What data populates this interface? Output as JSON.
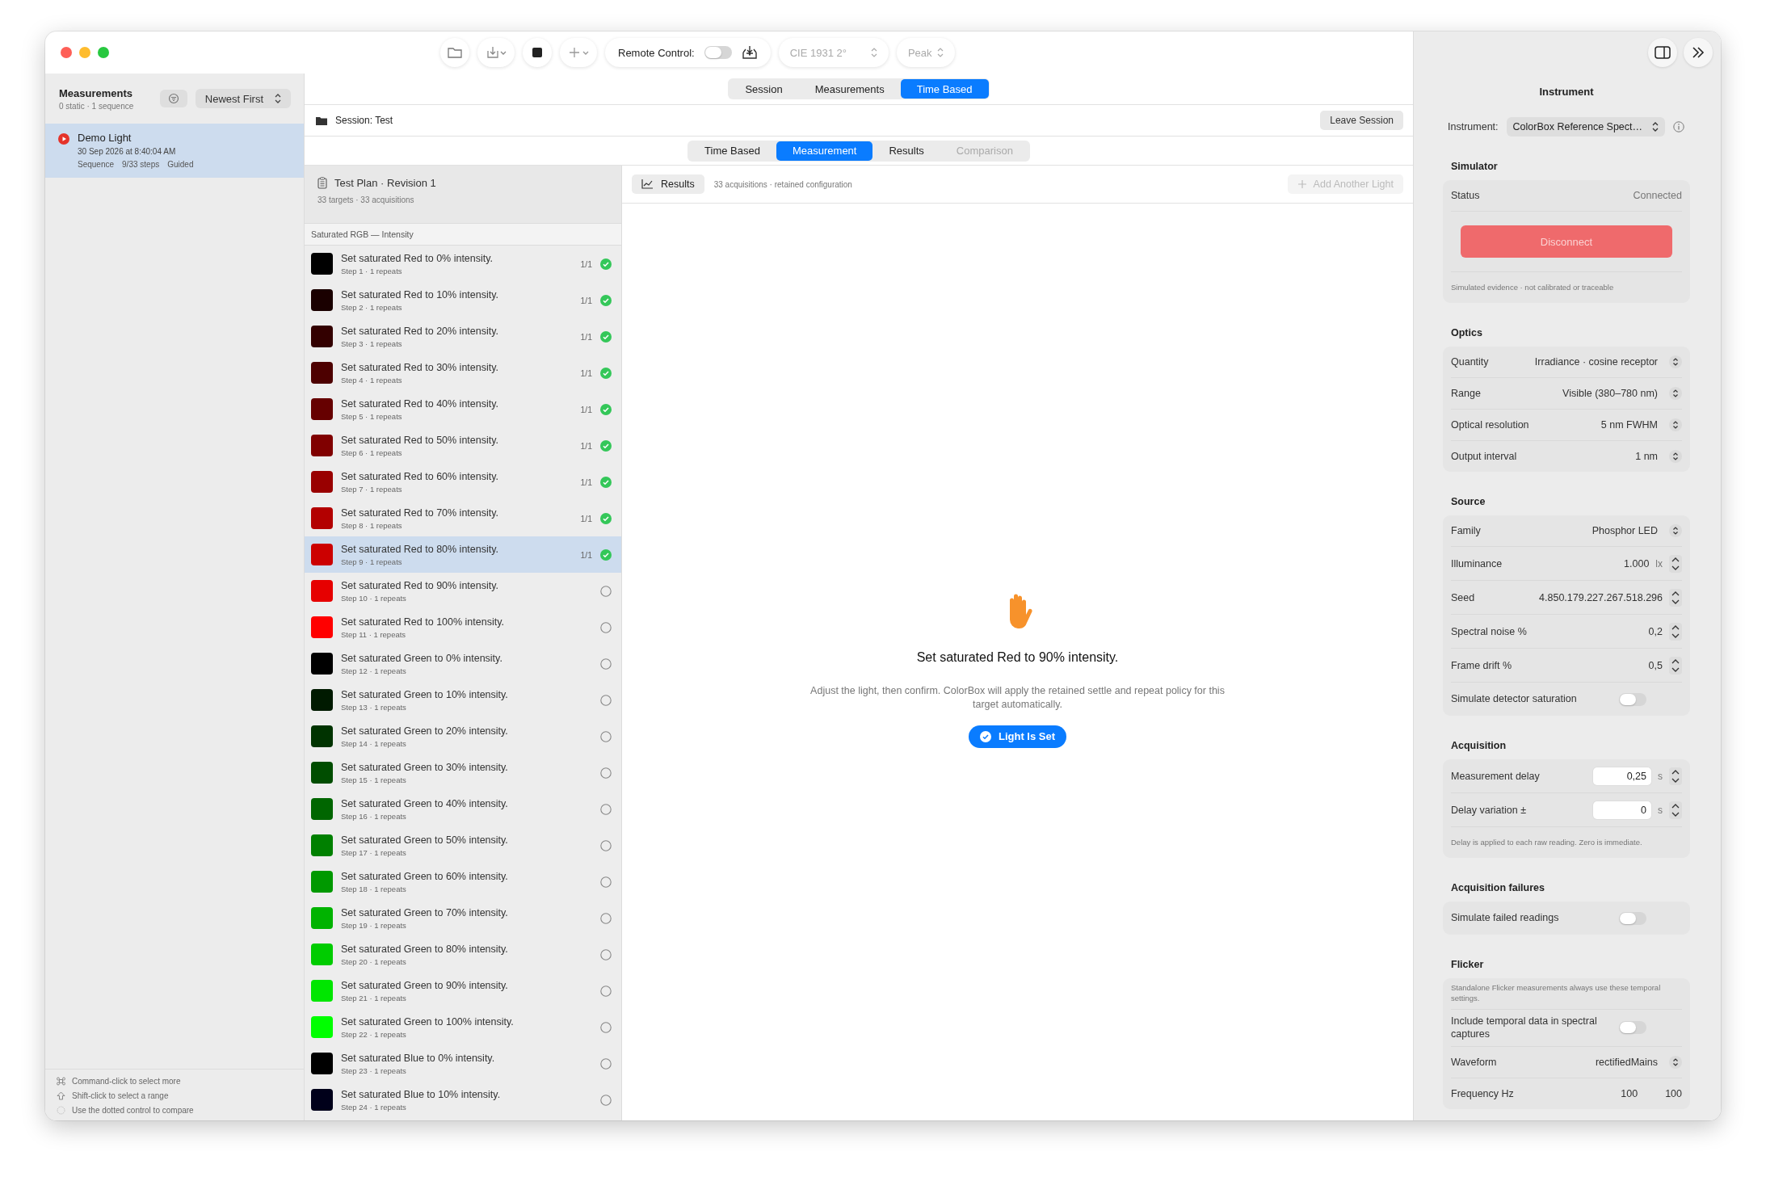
{
  "toolbar": {
    "remote_control": {
      "label": "Remote Control:",
      "on": false
    },
    "observer": {
      "value": "CIE 1931 2°",
      "disabled": true
    },
    "mode": {
      "value": "Peak",
      "disabled": true
    }
  },
  "main_tabs": [
    {
      "label": "Session",
      "selected": false
    },
    {
      "label": "Measurements",
      "selected": false
    },
    {
      "label": "Time Based",
      "selected": true
    }
  ],
  "sidebar": {
    "title": "Measurements",
    "subtitle": "0 static · 1 sequence",
    "sort": "Newest First",
    "items": [
      {
        "name": "Demo Light",
        "date": "30 Sep 2026 at 8:40:04 AM",
        "details": [
          "Sequence",
          "9/33 steps",
          "Guided"
        ],
        "selected": true
      }
    ],
    "hints": [
      {
        "kind": "command",
        "text": "Command-click to select more"
      },
      {
        "kind": "shift",
        "text": "Shift-click to select a range"
      },
      {
        "kind": "dotted",
        "text": "Use the dotted control to compare"
      }
    ]
  },
  "session": {
    "label": "Session: Test",
    "leave_button": "Leave Session"
  },
  "sub_tabs": [
    {
      "label": "Time Based",
      "selected": false,
      "disabled": false
    },
    {
      "label": "Measurement",
      "selected": true,
      "disabled": false
    },
    {
      "label": "Results",
      "selected": false,
      "disabled": false
    },
    {
      "label": "Comparison",
      "selected": false,
      "disabled": true
    }
  ],
  "plan": {
    "title": "Test Plan · Revision 1",
    "summary": "33 targets · 33 acquisitions",
    "section": "Saturated RGB — Intensity",
    "steps": [
      {
        "title": "Set saturated Red to 0% intensity.",
        "detail": "Step 1 · 1 repeats",
        "color": "#000000",
        "done": true,
        "count": "1/1",
        "selected": false
      },
      {
        "title": "Set saturated Red to 10% intensity.",
        "detail": "Step 2 · 1 repeats",
        "color": "#1a0000",
        "done": true,
        "count": "1/1",
        "selected": false
      },
      {
        "title": "Set saturated Red to 20% intensity.",
        "detail": "Step 3 · 1 repeats",
        "color": "#330000",
        "done": true,
        "count": "1/1",
        "selected": false
      },
      {
        "title": "Set saturated Red to 30% intensity.",
        "detail": "Step 4 · 1 repeats",
        "color": "#4d0000",
        "done": true,
        "count": "1/1",
        "selected": false
      },
      {
        "title": "Set saturated Red to 40% intensity.",
        "detail": "Step 5 · 1 repeats",
        "color": "#660000",
        "done": true,
        "count": "1/1",
        "selected": false
      },
      {
        "title": "Set saturated Red to 50% intensity.",
        "detail": "Step 6 · 1 repeats",
        "color": "#800000",
        "done": true,
        "count": "1/1",
        "selected": false
      },
      {
        "title": "Set saturated Red to 60% intensity.",
        "detail": "Step 7 · 1 repeats",
        "color": "#990000",
        "done": true,
        "count": "1/1",
        "selected": false
      },
      {
        "title": "Set saturated Red to 70% intensity.",
        "detail": "Step 8 · 1 repeats",
        "color": "#b30000",
        "done": true,
        "count": "1/1",
        "selected": false
      },
      {
        "title": "Set saturated Red to 80% intensity.",
        "detail": "Step 9 · 1 repeats",
        "color": "#cc0000",
        "done": true,
        "count": "1/1",
        "selected": true
      },
      {
        "title": "Set saturated Red to 90% intensity.",
        "detail": "Step 10 · 1 repeats",
        "color": "#e60000",
        "done": false,
        "selected": false
      },
      {
        "title": "Set saturated Red to 100% intensity.",
        "detail": "Step 11 · 1 repeats",
        "color": "#ff0000",
        "done": false,
        "selected": false
      },
      {
        "title": "Set saturated Green to 0% intensity.",
        "detail": "Step 12 · 1 repeats",
        "color": "#000000",
        "done": false,
        "selected": false
      },
      {
        "title": "Set saturated Green to 10% intensity.",
        "detail": "Step 13 · 1 repeats",
        "color": "#001a00",
        "done": false,
        "selected": false
      },
      {
        "title": "Set saturated Green to 20% intensity.",
        "detail": "Step 14 · 1 repeats",
        "color": "#003300",
        "done": false,
        "selected": false
      },
      {
        "title": "Set saturated Green to 30% intensity.",
        "detail": "Step 15 · 1 repeats",
        "color": "#004d00",
        "done": false,
        "selected": false
      },
      {
        "title": "Set saturated Green to 40% intensity.",
        "detail": "Step 16 · 1 repeats",
        "color": "#006600",
        "done": false,
        "selected": false
      },
      {
        "title": "Set saturated Green to 50% intensity.",
        "detail": "Step 17 · 1 repeats",
        "color": "#008000",
        "done": false,
        "selected": false
      },
      {
        "title": "Set saturated Green to 60% intensity.",
        "detail": "Step 18 · 1 repeats",
        "color": "#009900",
        "done": false,
        "selected": false
      },
      {
        "title": "Set saturated Green to 70% intensity.",
        "detail": "Step 19 · 1 repeats",
        "color": "#00b300",
        "done": false,
        "selected": false
      },
      {
        "title": "Set saturated Green to 80% intensity.",
        "detail": "Step 20 · 1 repeats",
        "color": "#00cc00",
        "done": false,
        "selected": false
      },
      {
        "title": "Set saturated Green to 90% intensity.",
        "detail": "Step 21 · 1 repeats",
        "color": "#00e600",
        "done": false,
        "selected": false
      },
      {
        "title": "Set saturated Green to 100% intensity.",
        "detail": "Step 22 · 1 repeats",
        "color": "#00ff00",
        "done": false,
        "selected": false
      },
      {
        "title": "Set saturated Blue to 0% intensity.",
        "detail": "Step 23 · 1 repeats",
        "color": "#000000",
        "done": false,
        "selected": false
      },
      {
        "title": "Set saturated Blue to 10% intensity.",
        "detail": "Step 24 · 1 repeats",
        "color": "#00001a",
        "done": false,
        "selected": false
      }
    ]
  },
  "results_bar": {
    "button": "Results",
    "summary": "33 acquisitions · retained configuration",
    "add_button": {
      "label": "Add Another Light",
      "disabled": true
    }
  },
  "prompt": {
    "title": "Set saturated Red to 90% intensity.",
    "description": "Adjust the light, then confirm. ColorBox will apply the retained settle and repeat policy for this target automatically.",
    "button": "Light Is Set"
  },
  "inspector": {
    "title": "Instrument",
    "instrument": {
      "label": "Instrument:",
      "value": "ColorBox Reference Spect…"
    },
    "sections": [
      {
        "title": "Simulator",
        "rows": [
          {
            "kind": "value",
            "label": "Status",
            "value": "Connected"
          },
          {
            "kind": "button",
            "label": "Disconnect"
          },
          {
            "kind": "note",
            "text": "Simulated evidence · not calibrated or traceable"
          }
        ]
      },
      {
        "title": "Optics",
        "rows": [
          {
            "kind": "popup",
            "label": "Quantity",
            "value": "Irradiance · cosine receptor"
          },
          {
            "kind": "popup",
            "label": "Range",
            "value": "Visible (380–780 nm)"
          },
          {
            "kind": "popup",
            "label": "Optical resolution",
            "value": "5 nm FWHM"
          },
          {
            "kind": "popup",
            "label": "Output interval",
            "value": "1 nm"
          }
        ]
      },
      {
        "title": "Source",
        "rows": [
          {
            "kind": "popup",
            "label": "Family",
            "value": "Phosphor LED"
          },
          {
            "kind": "stepper",
            "label": "Illuminance",
            "value": "1.000",
            "unit": "lx"
          },
          {
            "kind": "stepper",
            "label": "Seed",
            "value": "4.850.179.227.267.518.296"
          },
          {
            "kind": "stepper",
            "label": "Spectral noise %",
            "value": "0,2"
          },
          {
            "kind": "stepper",
            "label": "Frame drift %",
            "value": "0,5"
          },
          {
            "kind": "toggle",
            "label": "Simulate detector saturation",
            "on": false
          }
        ]
      },
      {
        "title": "Acquisition",
        "rows": [
          {
            "kind": "field",
            "label": "Measurement delay",
            "value": "0,25",
            "unit": "s"
          },
          {
            "kind": "field",
            "label": "Delay variation ±",
            "value": "0",
            "unit": "s"
          },
          {
            "kind": "note",
            "text": "Delay is applied to each raw reading. Zero is immediate."
          }
        ]
      },
      {
        "title": "Acquisition failures",
        "rows": [
          {
            "kind": "toggle",
            "label": "Simulate failed readings",
            "on": false
          }
        ]
      },
      {
        "title": "Flicker",
        "rows": [
          {
            "kind": "note",
            "text": "Standalone Flicker measurements always use these temporal settings."
          },
          {
            "kind": "toggle",
            "label": "Include temporal data in spectral captures",
            "on": false
          },
          {
            "kind": "popup",
            "label": "Waveform",
            "value": "rectifiedMains"
          },
          {
            "kind": "pair",
            "label": "Frequency Hz",
            "value": "100",
            "value2": "100"
          }
        ]
      }
    ]
  }
}
